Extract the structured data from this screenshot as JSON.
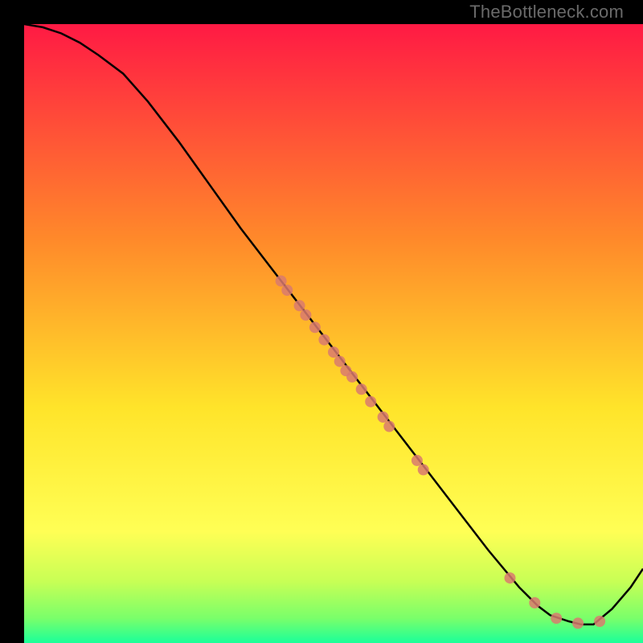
{
  "watermark": "TheBottleneck.com",
  "colors": {
    "gradient_top": "#ff1a44",
    "gradient_mid1": "#ff8a2a",
    "gradient_mid2": "#ffe42a",
    "gradient_low1": "#d9ff2a",
    "gradient_low2": "#7aff6a",
    "gradient_bottom": "#1aff9a",
    "curve": "#000000",
    "points": "#d97a6f"
  },
  "chart_data": {
    "type": "line",
    "title": "",
    "xlabel": "",
    "ylabel": "",
    "xlim": [
      0,
      100
    ],
    "ylim": [
      0,
      100
    ],
    "curve": {
      "x": [
        0,
        3,
        6,
        9,
        12,
        16,
        20,
        25,
        30,
        35,
        40,
        45,
        50,
        55,
        60,
        65,
        70,
        75,
        80,
        83,
        85,
        88,
        90,
        92,
        95,
        98,
        100
      ],
      "y": [
        100,
        99.5,
        98.5,
        97,
        95,
        92,
        87.5,
        81,
        74,
        67,
        60.5,
        54,
        47.5,
        41,
        34.5,
        28,
        21.5,
        15,
        9,
        6,
        4.5,
        3.5,
        3,
        3,
        5.5,
        9,
        12
      ]
    },
    "points": [
      {
        "x": 41.5,
        "y": 58.5
      },
      {
        "x": 42.5,
        "y": 57.0
      },
      {
        "x": 44.5,
        "y": 54.5
      },
      {
        "x": 45.5,
        "y": 53.0
      },
      {
        "x": 47.0,
        "y": 51.0
      },
      {
        "x": 48.5,
        "y": 49.0
      },
      {
        "x": 50.0,
        "y": 47.0
      },
      {
        "x": 51.0,
        "y": 45.5
      },
      {
        "x": 52.0,
        "y": 44.0
      },
      {
        "x": 53.0,
        "y": 43.0
      },
      {
        "x": 54.5,
        "y": 41.0
      },
      {
        "x": 56.0,
        "y": 39.0
      },
      {
        "x": 58.0,
        "y": 36.5
      },
      {
        "x": 59.0,
        "y": 35.0
      },
      {
        "x": 63.5,
        "y": 29.5
      },
      {
        "x": 64.5,
        "y": 28.0
      },
      {
        "x": 78.5,
        "y": 10.5
      },
      {
        "x": 82.5,
        "y": 6.5
      },
      {
        "x": 86.0,
        "y": 4.0
      },
      {
        "x": 89.5,
        "y": 3.2
      },
      {
        "x": 93.0,
        "y": 3.5
      }
    ]
  }
}
